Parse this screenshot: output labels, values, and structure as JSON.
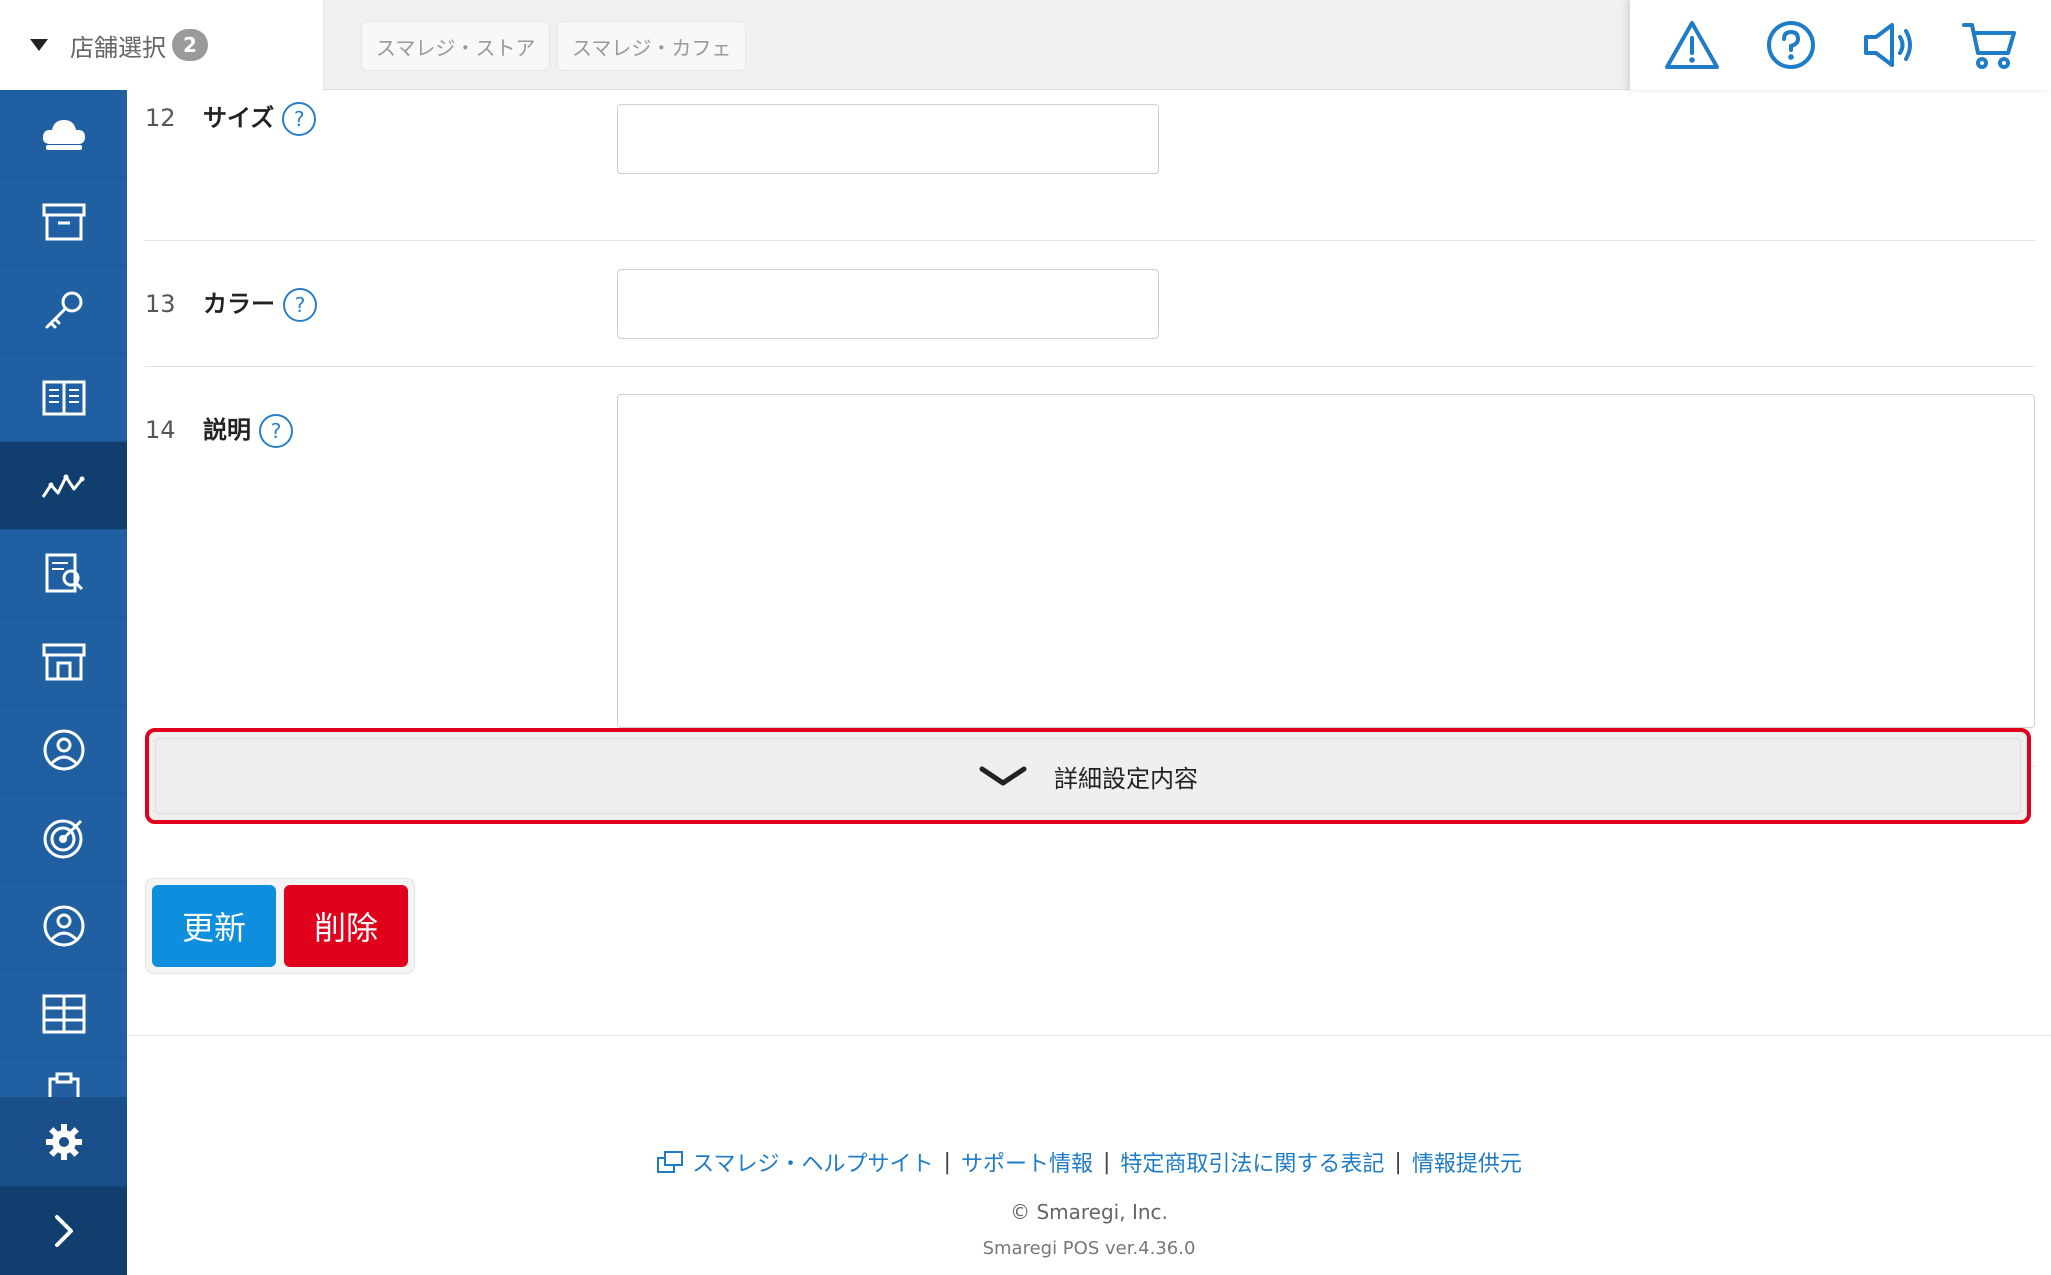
{
  "header": {
    "store_select_label": "店舗選択",
    "store_count": "2",
    "stores": [
      "スマレジ・ストア",
      "スマレジ・カフェ"
    ],
    "icons": [
      "warning-icon",
      "help-icon",
      "announcement-icon",
      "cart-icon"
    ],
    "accent_color": "#2b7fc6"
  },
  "sidebar": {
    "items": [
      "cloud-icon",
      "archive-box-icon",
      "key-icon",
      "book-icon",
      "analytics-icon",
      "report-icon",
      "store-icon",
      "staff-icon",
      "target-icon",
      "customer-icon",
      "grid-icon",
      "clipboard-icon"
    ],
    "active_index": 4,
    "bottom": [
      "settings-icon",
      "expand-icon"
    ],
    "color": "#1f5fa2"
  },
  "form": {
    "rows": [
      {
        "num": "12",
        "label": "サイズ",
        "value": ""
      },
      {
        "num": "13",
        "label": "カラー",
        "value": ""
      },
      {
        "num": "14",
        "label": "説明",
        "value": ""
      }
    ],
    "help_symbol": "?"
  },
  "detail_toggle": {
    "label": "詳細設定内容",
    "highlight_color": "#e0001b"
  },
  "actions": {
    "update_label": "更新",
    "delete_label": "削除",
    "update_color": "#0d8fde",
    "delete_color": "#e0001b"
  },
  "footer": {
    "links": [
      "スマレジ・ヘルプサイト",
      "サポート情報",
      "特定商取引法に関する表記",
      "情報提供元"
    ],
    "separator": "|",
    "copyright": "© Smaregi, Inc.",
    "version": "Smaregi POS ver.4.36.0"
  }
}
